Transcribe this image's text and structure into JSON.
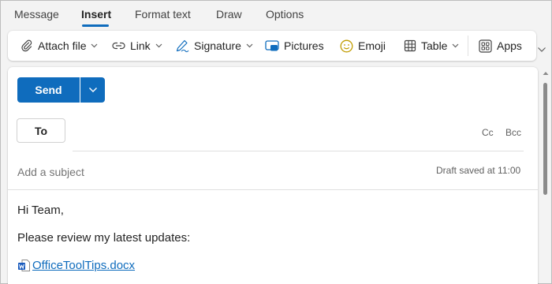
{
  "tabs": [
    {
      "label": "Message",
      "active": false
    },
    {
      "label": "Insert",
      "active": true
    },
    {
      "label": "Format text",
      "active": false
    },
    {
      "label": "Draw",
      "active": false
    },
    {
      "label": "Options",
      "active": false
    }
  ],
  "ribbon": {
    "attach_file": {
      "label": "Attach file",
      "icon": "paperclip-icon"
    },
    "link": {
      "label": "Link",
      "icon": "link-icon"
    },
    "signature": {
      "label": "Signature",
      "icon": "pen-icon"
    },
    "pictures": {
      "label": "Pictures",
      "icon": "picture-icon"
    },
    "emoji": {
      "label": "Emoji",
      "icon": "smiley-icon"
    },
    "table": {
      "label": "Table",
      "icon": "table-icon"
    },
    "apps": {
      "label": "Apps",
      "icon": "apps-icon"
    }
  },
  "compose": {
    "send_label": "Send",
    "to_label": "To",
    "to_value": "",
    "cc_label": "Cc",
    "bcc_label": "Bcc",
    "subject_placeholder": "Add a subject",
    "subject_value": "",
    "draft_status": "Draft saved at 11:00",
    "body_lines": [
      "Hi Team,",
      "Please review my latest updates:"
    ],
    "attachment": {
      "name": "OfficeToolTips.docx",
      "icon": "word-doc-icon"
    }
  },
  "colors": {
    "accent": "#0f6cbd",
    "text": "#242424",
    "muted": "#616161",
    "background": "#f3f3f3"
  }
}
